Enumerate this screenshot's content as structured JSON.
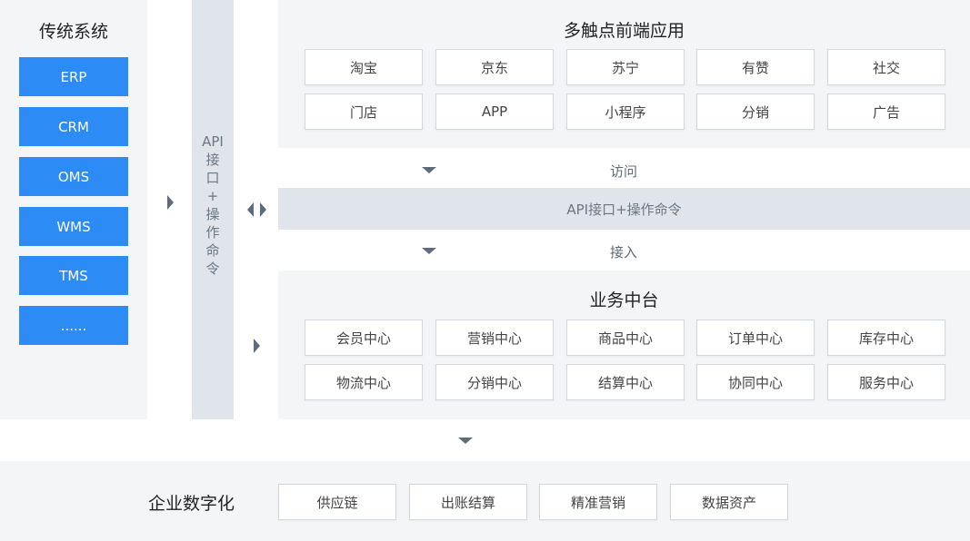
{
  "legacy": {
    "title": "传统系统",
    "items": [
      "ERP",
      "CRM",
      "OMS",
      "WMS",
      "TMS",
      "......"
    ]
  },
  "api_column": {
    "chars": [
      "API",
      "接",
      "口",
      "+",
      "操",
      "作",
      "命",
      "令"
    ]
  },
  "frontend": {
    "title": "多触点前端应用",
    "items": [
      "淘宝",
      "京东",
      "苏宁",
      "有赞",
      "社交",
      "门店",
      "APP",
      "小程序",
      "分销",
      "广告"
    ]
  },
  "flow": {
    "access_label": "访问",
    "bar_label": "API接口+操作命令",
    "connect_label": "接入"
  },
  "business": {
    "title": "业务中台",
    "items": [
      "会员中心",
      "营销中心",
      "商品中心",
      "订单中心",
      "库存中心",
      "物流中心",
      "分销中心",
      "结算中心",
      "协同中心",
      "服务中心"
    ]
  },
  "enterprise": {
    "title": "企业数字化",
    "items": [
      "供应链",
      "出账结算",
      "精准营销",
      "数据资产"
    ]
  }
}
